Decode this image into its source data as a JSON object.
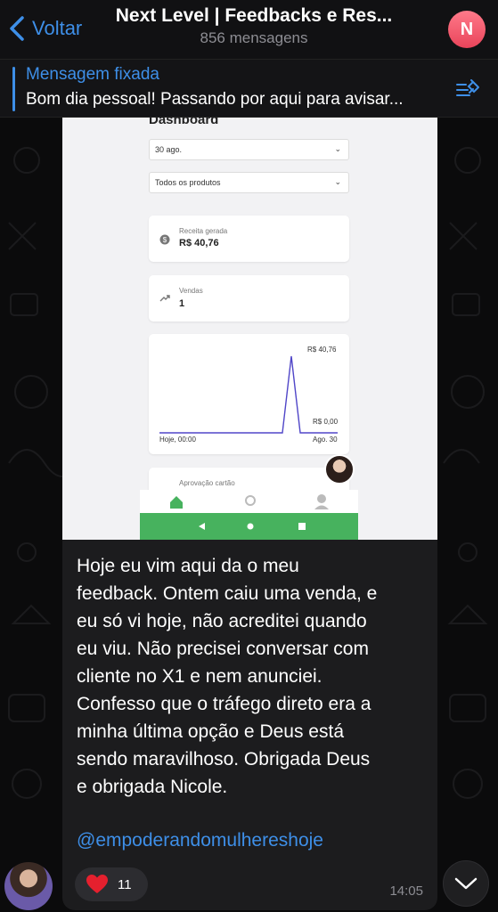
{
  "header": {
    "back_label": "Voltar",
    "title": "Next Level | Feedbacks e Res...",
    "subtitle": "856 mensagens",
    "avatar_letter": "N",
    "avatar_color": "#e9445a"
  },
  "pinned": {
    "title": "Mensagem fixada",
    "text": "Bom dia pessoal! Passando por aqui para avisar..."
  },
  "embedded_screenshot": {
    "title": "Dashboard",
    "date_select": "30 ago.",
    "product_select": "Todos os produtos",
    "revenue_label": "Receita gerada",
    "revenue_value": "R$ 40,76",
    "sales_label": "Vendas",
    "sales_value": "1",
    "chart_max_label": "R$ 40,76",
    "chart_min_label": "R$ 0,00",
    "chart_start_label": "Hoje, 00:00",
    "chart_end_label": "Ago. 30",
    "approval_label": "Aprovação cartão",
    "accent_color": "#47b25e",
    "line_color": "#5046c8"
  },
  "message": {
    "text": "Hoje eu vim aqui da o meu\nfeedback. Ontem caiu uma venda, e\neu só vi hoje, não acreditei quando\neu viu. Não precisei  conversar com\ncliente no X1 e nem anunciei.\nConfesso que o tráfego direto era a\nminha última opção e Deus está\nsendo maravilhoso. Obrigada Deus\ne obrigada Nicole.",
    "mention": "@empoderandomulhereshoje",
    "reaction_emoji": "heart",
    "reaction_count": "11",
    "time": "14:05"
  }
}
